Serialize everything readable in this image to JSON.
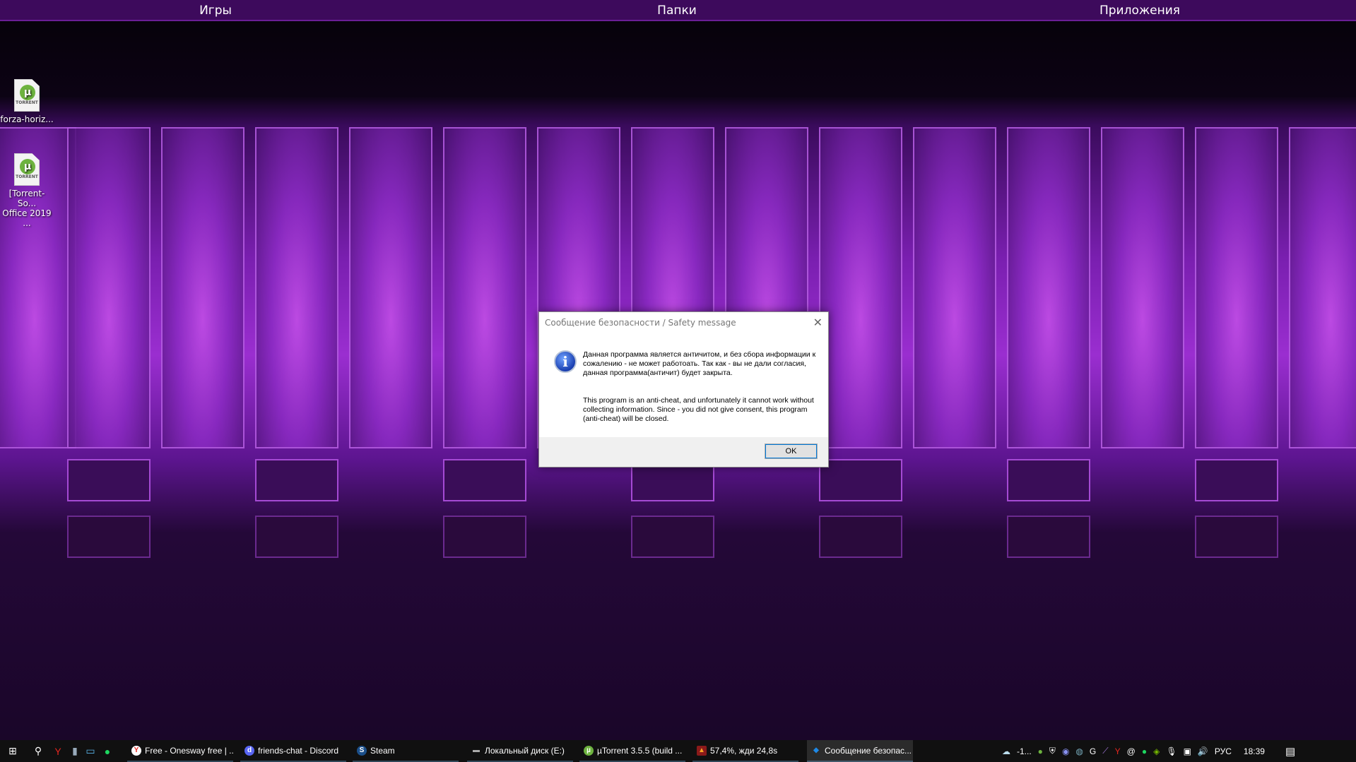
{
  "topbar": {
    "items": [
      "Игры",
      "Папки",
      "Приложения"
    ]
  },
  "desktop_icons": [
    {
      "label1": "forza-horiz...",
      "label2": "",
      "badge": "TORRENT"
    },
    {
      "label1": "[Torrent-So...",
      "label2": "Office 2019 ...",
      "badge": "TORRENT"
    }
  ],
  "dialog": {
    "title": "Сообщение безопасности / Safety message",
    "message_ru": "Данная программа является античитом, и без сбора информации к сожалению - не может работоать. Так как - вы не дали согласия, данная программа(античит) будет закрыта.",
    "message_en": "This program is an anti-cheat, and unfortunately it cannot work without collecting information. Since - you did not give consent, this program (anti-cheat) will be closed.",
    "ok_label": "OK",
    "close_glyph": "✕",
    "icon": "info-icon"
  },
  "taskbar": {
    "buttons": [
      {
        "label": "Free - Onesway free | ...",
        "icon": "yandex-browser-icon",
        "color": "#e52620",
        "glyph": "Y"
      },
      {
        "label": "friends-chat - Discord",
        "icon": "discord-icon",
        "color": "#5865f2",
        "glyph": "d"
      },
      {
        "label": "Steam",
        "icon": "steam-icon",
        "color": "#1b4f8a",
        "glyph": "S"
      },
      {
        "label": "Локальный диск (E:)",
        "icon": "drive-icon",
        "color": "#888888",
        "glyph": "▬"
      },
      {
        "label": "µTorrent 3.5.5  (build ...",
        "icon": "utorrent-icon",
        "color": "#6db33f",
        "glyph": "µ"
      },
      {
        "label": "57,4%, жди 24,8s",
        "icon": "app-warning-icon",
        "color": "#c0392b",
        "glyph": "▲"
      },
      {
        "label": "Сообщение безопас...",
        "icon": "shield-icon",
        "color": "#1e88e5",
        "glyph": "◆"
      }
    ],
    "weather": "-1...",
    "language": "РУС",
    "time": "18:39"
  }
}
